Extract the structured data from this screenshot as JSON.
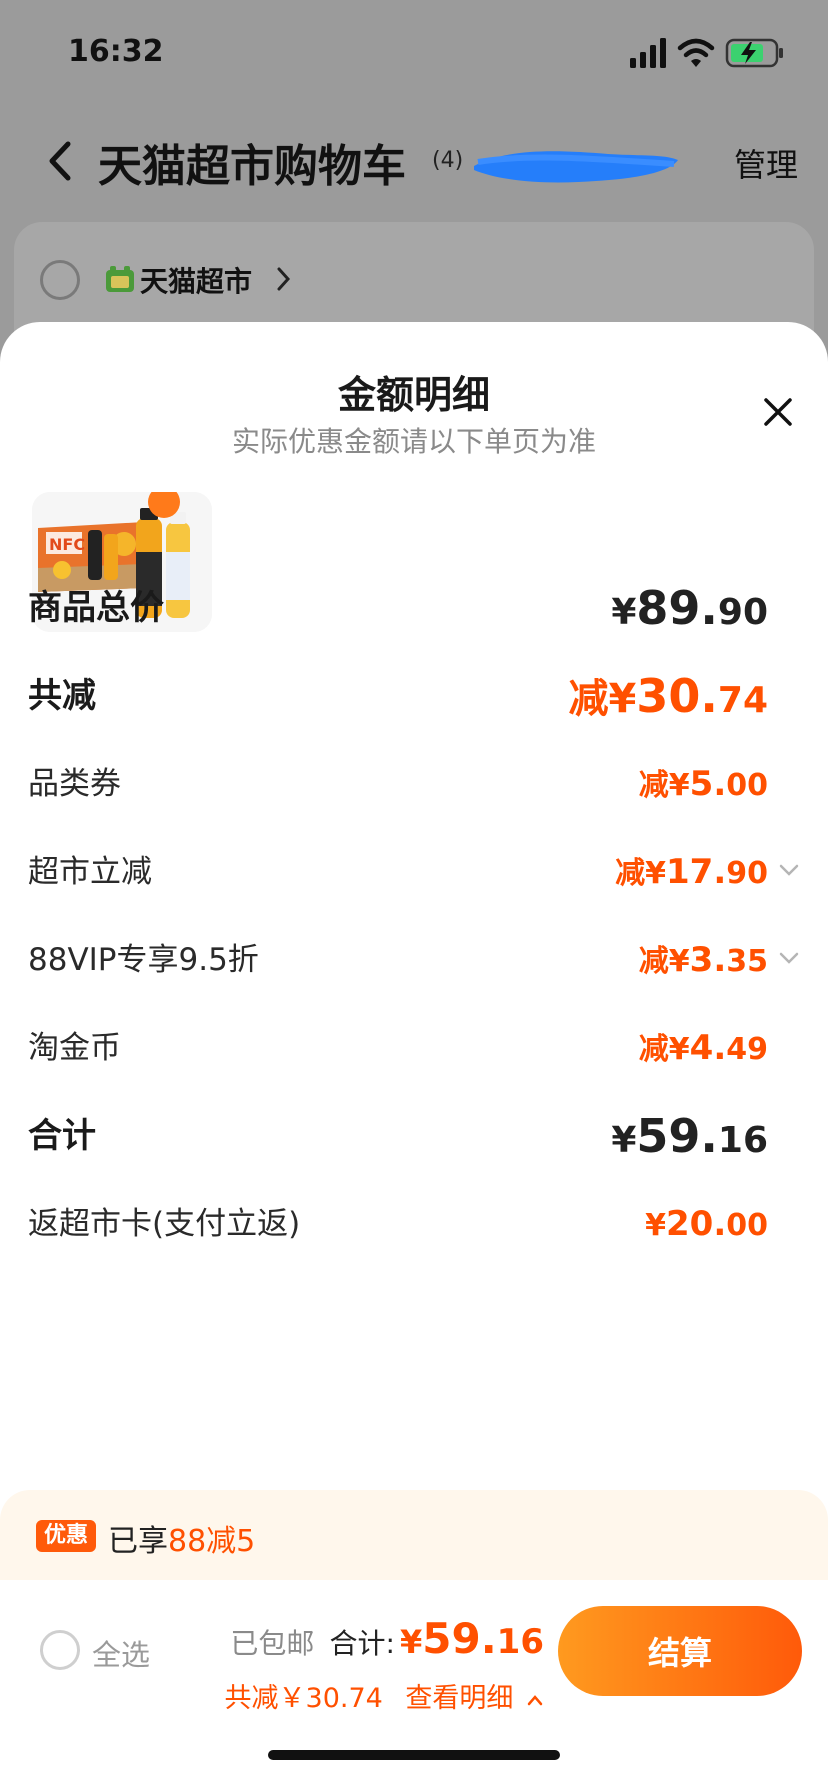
{
  "status_bar": {
    "time": "16:32"
  },
  "header": {
    "title": "天猫超市购物车",
    "count": "(4)",
    "manage_label": "管理"
  },
  "store": {
    "name": "天猫超市"
  },
  "sheet": {
    "title": "金额明细",
    "subtitle": "实际优惠金额请以下单页为准"
  },
  "rows": [
    {
      "label": "商品总价",
      "prefix": "¥",
      "int": "89.",
      "dec": "90"
    },
    {
      "label": "共减",
      "prefix": "减¥",
      "int": "30.",
      "dec": "74"
    },
    {
      "label": "品类券",
      "prefix": "减¥",
      "int": "5.",
      "dec": "00"
    },
    {
      "label": "超市立减",
      "prefix": "减¥",
      "int": "17.",
      "dec": "90"
    },
    {
      "label": "88VIP专享9.5折",
      "prefix": "减¥",
      "int": "3.",
      "dec": "35"
    },
    {
      "label": "淘金币",
      "prefix": "减¥",
      "int": "4.",
      "dec": "49"
    },
    {
      "label": "合计",
      "prefix": "¥",
      "int": "59.",
      "dec": "16"
    },
    {
      "label": "返超市卡(支付立返)",
      "prefix": "¥",
      "int": "20.",
      "dec": "00"
    }
  ],
  "promo": {
    "badge": "优惠",
    "text_prefix": "已享",
    "text_highlight": "88减5"
  },
  "checkout": {
    "select_all_label": "全选",
    "shipping_label": "已包邮",
    "total_label": "合计:",
    "total_prefix": "¥",
    "total_int": "59.",
    "total_dec": "16",
    "discount_text": "共减￥30.74",
    "detail_link": "查看明细",
    "button_label": "结算"
  },
  "colors": {
    "accent": "#ff5000",
    "button_gradient_start": "#ff9a1f",
    "button_gradient_end": "#ff5a0a",
    "overlay_bg": "#9b9b9b"
  },
  "icons": [
    "back-arrow-icon",
    "signal-icon",
    "wifi-icon",
    "battery-icon",
    "store-logo-icon",
    "chevron-right-icon",
    "close-icon",
    "chevron-down-icon",
    "chevron-up-icon"
  ]
}
